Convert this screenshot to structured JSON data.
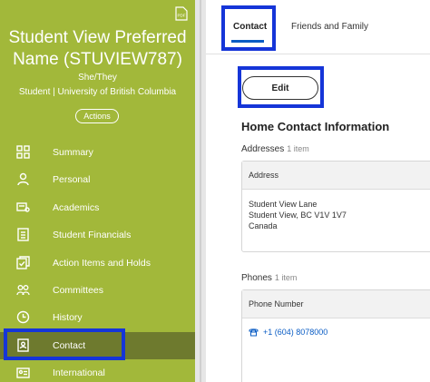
{
  "sidebar": {
    "name_line1": "Student View Preferred",
    "name_line2": "Name (STUVIEW787)",
    "pronouns": "She/They",
    "affiliation": "Student | University of British Columbia",
    "actions_label": "Actions",
    "pdf_icon_text": "PDF",
    "items": [
      {
        "label": "Summary",
        "icon": "grid-icon"
      },
      {
        "label": "Personal",
        "icon": "person-icon"
      },
      {
        "label": "Academics",
        "icon": "diploma-icon"
      },
      {
        "label": "Student Financials",
        "icon": "document-list-icon"
      },
      {
        "label": "Action Items and Holds",
        "icon": "checklist-icon"
      },
      {
        "label": "Committees",
        "icon": "group-icon"
      },
      {
        "label": "History",
        "icon": "clock-icon"
      },
      {
        "label": "Contact",
        "icon": "contact-card-icon",
        "active": true
      },
      {
        "label": "International",
        "icon": "id-card-icon"
      }
    ]
  },
  "tabs": [
    {
      "label": "Contact",
      "active": true
    },
    {
      "label": "Friends and Family"
    }
  ],
  "edit_label": "Edit",
  "section_title": "Home Contact Information",
  "addresses": {
    "label": "Addresses",
    "count": "1 item",
    "column": "Address",
    "line1": "Student View Lane",
    "line2": "Student View, BC V1V 1V7",
    "line3": "Canada"
  },
  "phones": {
    "label": "Phones",
    "count": "1 item",
    "column": "Phone Number",
    "number": "+1 (604) 8078000"
  },
  "colors": {
    "sidebar_bg": "#a2b83a",
    "active_item_bg": "#6e7a2e",
    "highlight": "#1535d8",
    "link": "#0a5cc4"
  }
}
